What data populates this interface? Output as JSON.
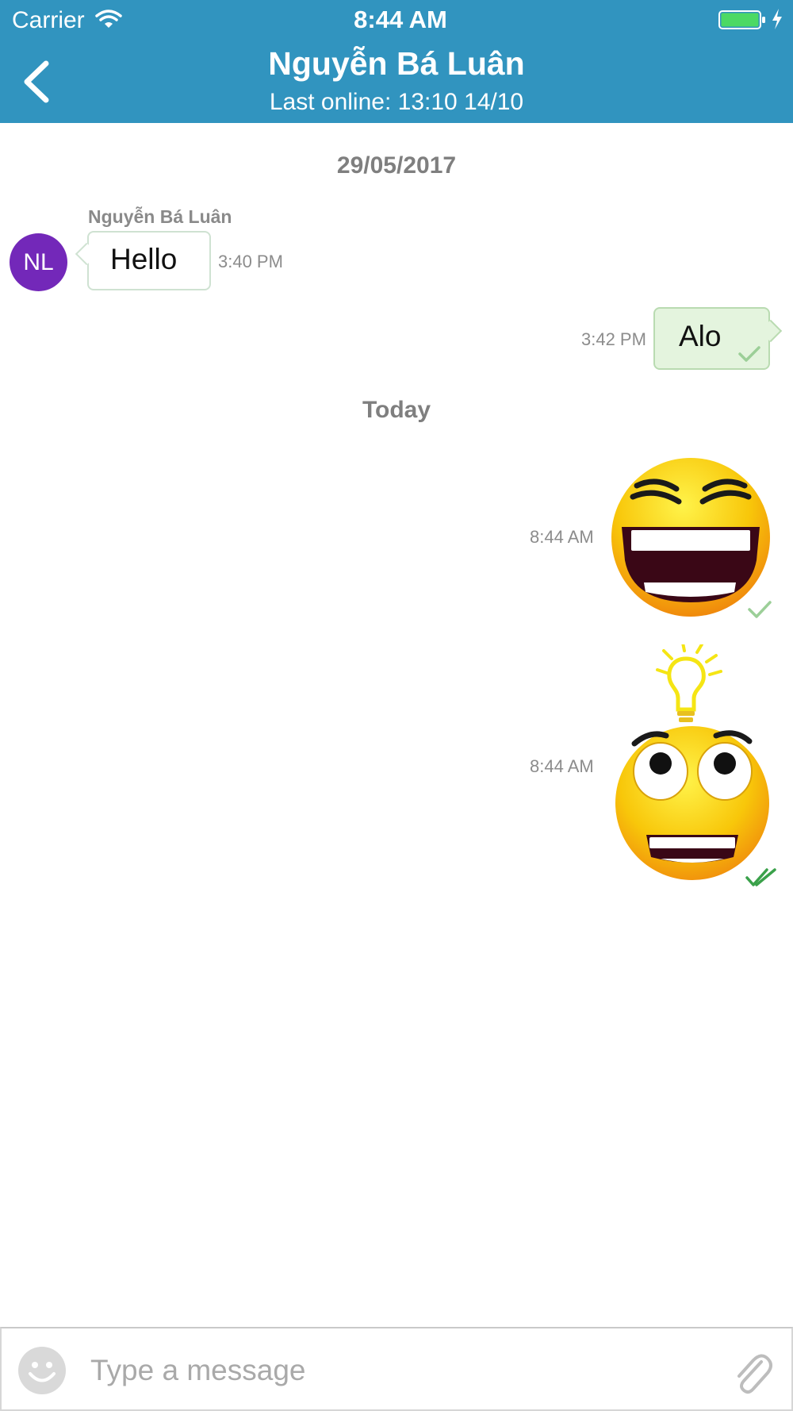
{
  "status_bar": {
    "carrier": "Carrier",
    "time": "8:44 AM",
    "battery_color": "#4cd964"
  },
  "header": {
    "title": "Nguyễn Bá Luân",
    "subtitle": "Last online: 13:10 14/10",
    "background": "#3194bf",
    "back_icon": "chevron-left-icon"
  },
  "conversation": {
    "date_separators": [
      "29/05/2017",
      "Today"
    ],
    "contact": {
      "initials": "NL",
      "name": "Nguyễn Bá Luân",
      "avatar_color": "#7328b9"
    },
    "messages": [
      {
        "direction": "incoming",
        "type": "text",
        "text": "Hello",
        "time": "3:40 PM"
      },
      {
        "direction": "outgoing",
        "type": "text",
        "text": "Alo",
        "time": "3:42 PM",
        "status": "sent"
      },
      {
        "direction": "outgoing",
        "type": "sticker",
        "sticker": "laughing-face",
        "time": "8:44 AM",
        "status": "sent"
      },
      {
        "direction": "outgoing",
        "type": "sticker",
        "sticker": "idea-lightbulb-face",
        "time": "8:44 AM",
        "status": "read"
      }
    ]
  },
  "input_bar": {
    "placeholder": "Type a message",
    "emoji_icon": "smiley-icon",
    "attach_icon": "paperclip-icon"
  },
  "colors": {
    "outgoing_bubble": "#e4f4de",
    "tick_sent": "#9ccf98",
    "tick_read": "#3aa14a",
    "meta_text": "#8c8c8c"
  }
}
